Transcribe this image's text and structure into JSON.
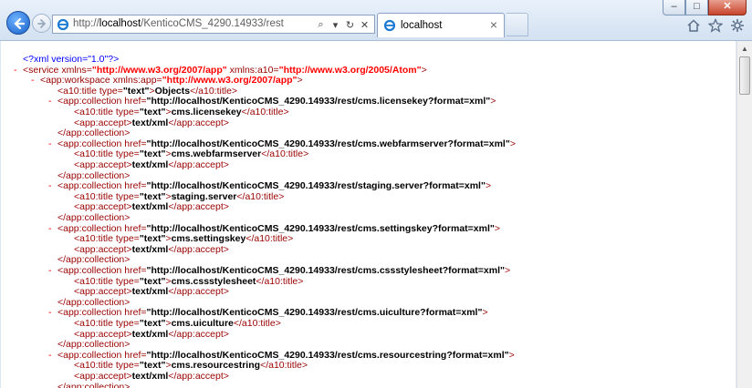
{
  "browser": {
    "address_prefix": "http://",
    "address_host": "localhost",
    "address_path": "/KenticoCMS_4290.14933/rest",
    "tab_title": "localhost",
    "tab_close": "×",
    "new_tab": "",
    "window_min": "–",
    "window_max": "□",
    "window_close": "✕",
    "addr_search": "⌕",
    "addr_dropdown": "▾",
    "addr_refresh": "↻",
    "addr_stop": "✕"
  },
  "xml": {
    "decl": "<?xml version=\"1.0\"?>",
    "service_open": "<service ",
    "service_attr1": "xmlns=",
    "service_val1": "\"http://www.w3.org/2007/app\"",
    "service_attr2": " xmlns:a10=",
    "service_val2": "\"http://www.w3.org/2005/Atom\"",
    "service_close": ">",
    "ws_open": "<app:workspace ",
    "ws_attr": "xmlns:app=",
    "ws_val": "\"http://www.w3.org/2007/app\"",
    "ws_close": ">",
    "ws_title_open": "<a10:title ",
    "ws_title_attr": "type=",
    "ws_title_val": "\"text\"",
    "ws_title_gt": ">",
    "ws_title_text": "Objects",
    "ws_title_end": "</a10:title>",
    "collections": [
      {
        "href": "\"http://localhost/KenticoCMS_4290.14933/rest/cms.licensekey?format=xml\"",
        "title": "cms.licensekey"
      },
      {
        "href": "\"http://localhost/KenticoCMS_4290.14933/rest/cms.webfarmserver?format=xml\"",
        "title": "cms.webfarmserver"
      },
      {
        "href": "\"http://localhost/KenticoCMS_4290.14933/rest/staging.server?format=xml\"",
        "title": "staging.server"
      },
      {
        "href": "\"http://localhost/KenticoCMS_4290.14933/rest/cms.settingskey?format=xml\"",
        "title": "cms.settingskey"
      },
      {
        "href": "\"http://localhost/KenticoCMS_4290.14933/rest/cms.cssstylesheet?format=xml\"",
        "title": "cms.cssstylesheet"
      },
      {
        "href": "\"http://localhost/KenticoCMS_4290.14933/rest/cms.uiculture?format=xml\"",
        "title": "cms.uiculture"
      },
      {
        "href": "\"http://localhost/KenticoCMS_4290.14933/rest/cms.resourcestring?format=xml\"",
        "title": "cms.resourcestring"
      }
    ],
    "coll_open": "<app:collection ",
    "coll_attr": "href=",
    "coll_gt": ">",
    "coll_end": "</app:collection>",
    "title_open": "<a10:title ",
    "title_attr": "type=",
    "title_val": "\"text\"",
    "title_gt": ">",
    "title_end": "</a10:title>",
    "accept_open": "<app:accept>",
    "accept_text": "text/xml",
    "accept_end": "</app:accept>",
    "minus": "-"
  },
  "colors": {
    "markup": "#990000",
    "attr_value": "#ff0000",
    "minus": "#ff0000",
    "decl": "#0000ff"
  },
  "icons": [
    "back-icon",
    "forward-icon",
    "ie-icon",
    "search-icon",
    "refresh-icon",
    "stop-icon",
    "home-icon",
    "favorites-icon",
    "tools-icon"
  ]
}
